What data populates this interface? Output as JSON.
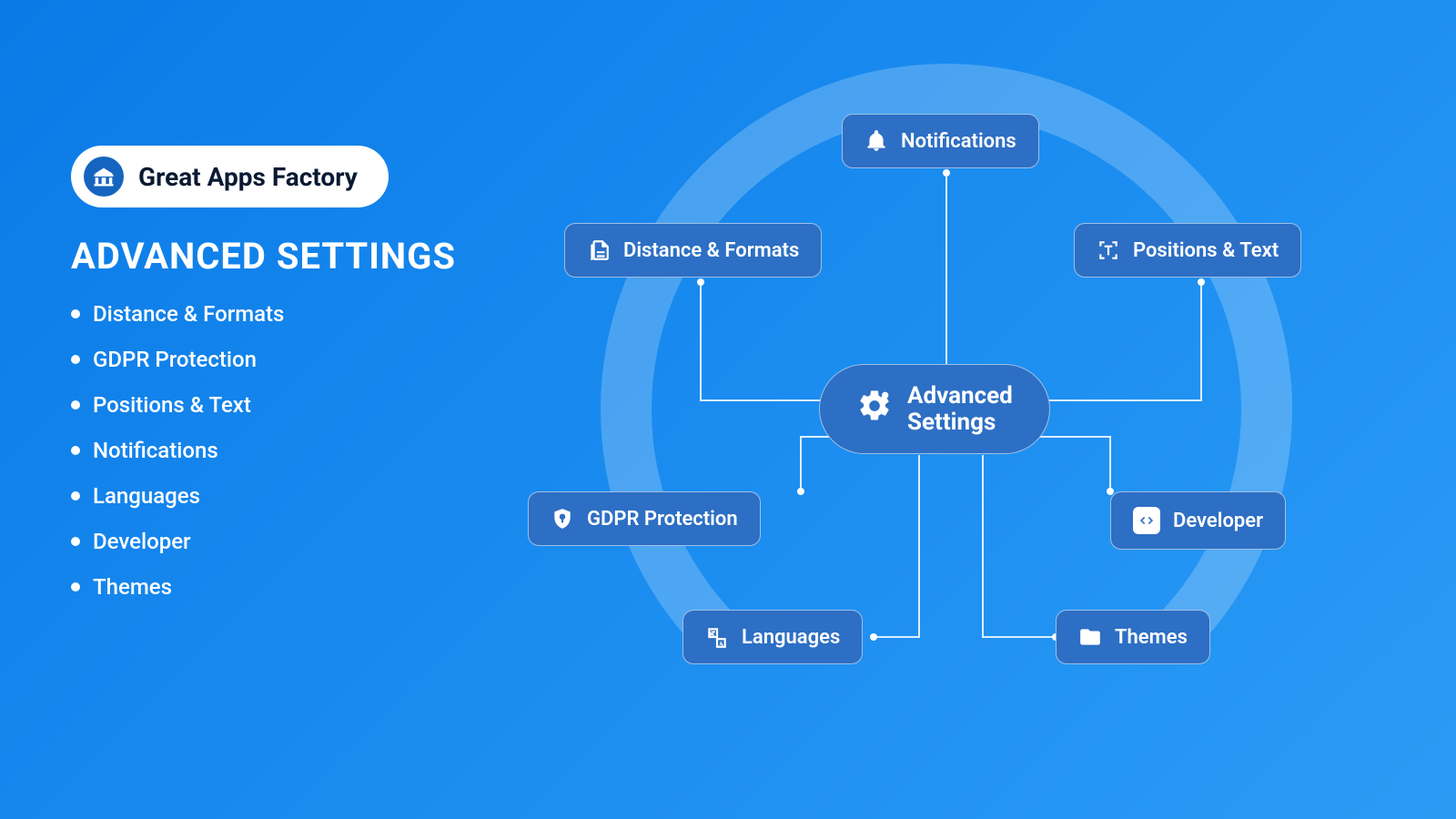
{
  "brand": {
    "name": "Great Apps Factory"
  },
  "left": {
    "title": "ADVANCED SETTINGS",
    "items": [
      "Distance & Formats",
      "GDPR Protection",
      "Positions & Text",
      "Notifications",
      "Languages",
      "Developer",
      "Themes"
    ]
  },
  "diagram": {
    "center": {
      "line1": "Advanced",
      "line2": "Settings"
    },
    "nodes": {
      "notifications": "Notifications",
      "distance": "Distance & Formats",
      "positions": "Positions & Text",
      "gdpr": "GDPR Protection",
      "developer": "Developer",
      "languages": "Languages",
      "themes": "Themes"
    }
  }
}
